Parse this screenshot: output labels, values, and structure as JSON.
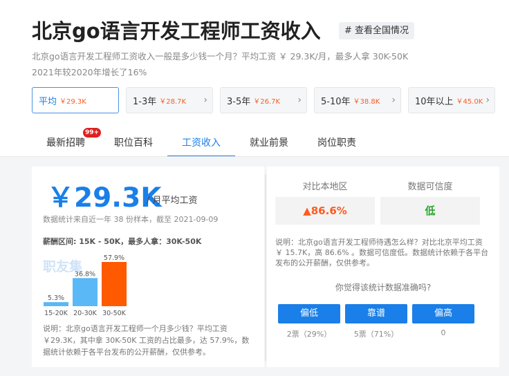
{
  "header": {
    "title": "北京go语言开发工程师工资收入",
    "view_all": "# 查看全国情况",
    "desc_line1": "北京go语言开发工程师工资收入一般是多少钱一个月？平均工资 ￥ 29.3K/月，最多人拿 30K-50K",
    "desc_line2": "2021年较2020年增长了16%"
  },
  "ranges": [
    {
      "label": "平均",
      "value": "￥29.3K",
      "active": true
    },
    {
      "label": "1-3年",
      "value": "￥28.7K"
    },
    {
      "label": "3-5年",
      "value": "￥26.7K"
    },
    {
      "label": "5-10年",
      "value": "￥38.8K"
    },
    {
      "label": "10年以上",
      "value": "￥45.0K"
    }
  ],
  "tabs": [
    {
      "label": "最新招聘",
      "badge": "99+"
    },
    {
      "label": "职位百科"
    },
    {
      "label": "工资收入",
      "active": true
    },
    {
      "label": "就业前景"
    },
    {
      "label": "岗位职责"
    }
  ],
  "salary": {
    "avg": "￥29.3K",
    "avg_label": "/ 月平均工资",
    "sample": "数据统计来自近一年 38 份样本，截至 2021-09-09",
    "range_line": "薪酬区间: 15K - 50K，最多人拿：30K-50K",
    "watermark": "职友集",
    "note": "说明：北京go语言开发工程师一个月多少钱？平均工资 ￥29.3K，其中拿 30K-50K 工资的占比最多，达 57.9%，数据统计依赖于各平台发布的公开薪酬，仅供参考。"
  },
  "chart_data": {
    "type": "bar",
    "categories": [
      "15-20K",
      "20-30K",
      "30-50K"
    ],
    "values": [
      5.3,
      36.8,
      57.9
    ],
    "value_labels": [
      "5.3%",
      "36.8%",
      "57.9%"
    ],
    "colors": [
      "#5ab8f6",
      "#5ab8f6",
      "#ff5a00"
    ]
  },
  "compare": {
    "head_region": "对比本地区",
    "head_trust": "数据可信度",
    "region_value": "86.6%",
    "trust_value": "低",
    "note": "说明：北京go语言开发工程师待遇怎么样？对比北京平均工资 ￥ 15.7K，高 86.6% 。数据可信度低。数据统计依赖于各平台发布的公开薪酬，仅供参考。",
    "question": "你觉得该统计数据准确吗?",
    "votes": [
      {
        "label": "偏低",
        "count": "2票（29%）"
      },
      {
        "label": "靠谱",
        "count": "5票（71%）"
      },
      {
        "label": "偏高",
        "count": "0"
      }
    ]
  }
}
